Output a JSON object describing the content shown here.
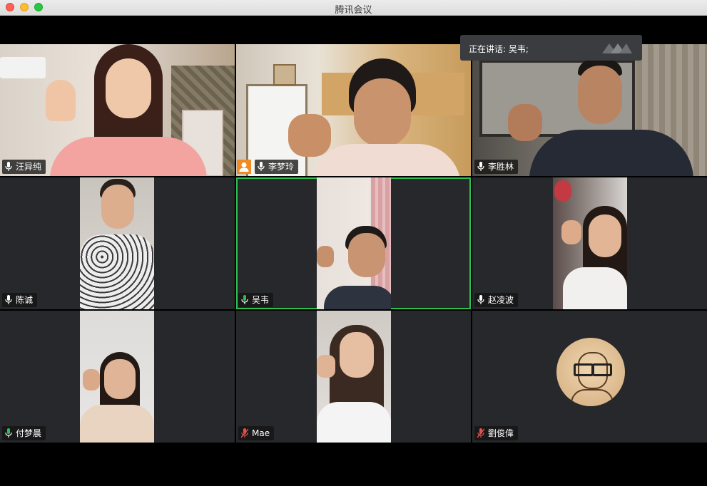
{
  "window": {
    "title": "腾讯会议"
  },
  "speaking": {
    "text": "正在讲话: 吴韦;"
  },
  "participants": [
    {
      "name": "汪异纯",
      "mic": "on"
    },
    {
      "name": "李梦玲",
      "mic": "on",
      "host": true
    },
    {
      "name": "李胜林",
      "mic": "on"
    },
    {
      "name": "陈诚",
      "mic": "on"
    },
    {
      "name": "吴韦",
      "mic": "on",
      "speaking": true
    },
    {
      "name": "赵凌波",
      "mic": "on"
    },
    {
      "name": "付梦晨",
      "mic": "on"
    },
    {
      "name": "Mae",
      "mic": "muted"
    },
    {
      "name": "劉俊偉",
      "mic": "muted"
    }
  ],
  "colors": {
    "active_border": "#2ec04f",
    "host_badge": "#f08a24",
    "muted_mic": "#e0524a",
    "live_mic": "#ffffff"
  }
}
